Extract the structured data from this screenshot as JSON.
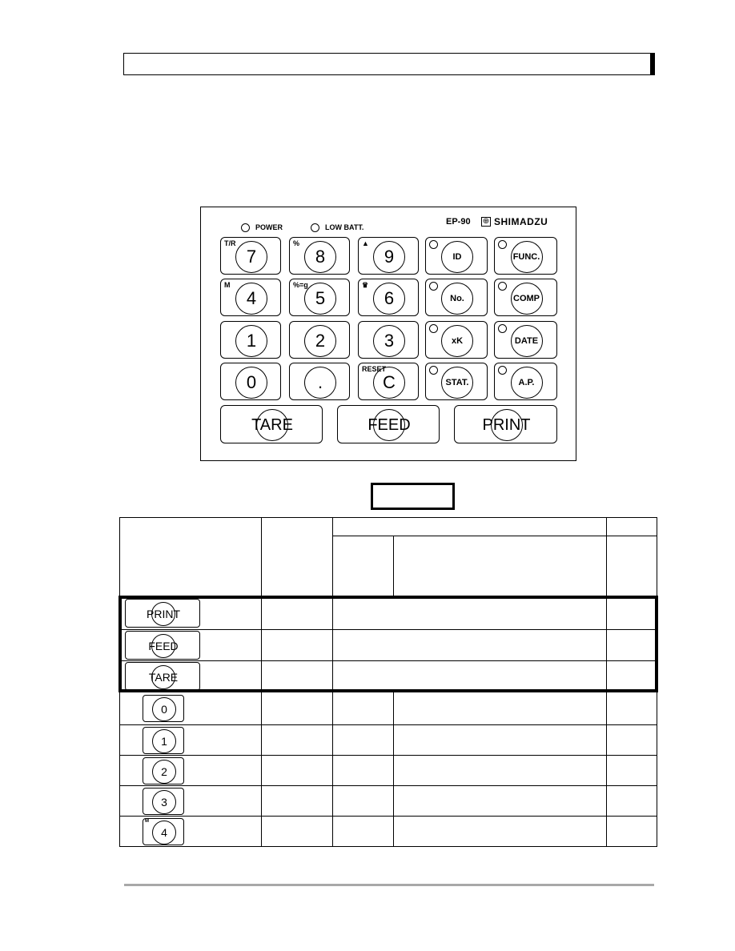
{
  "panel": {
    "model": "EP-90",
    "brand": "SHIMADZU",
    "indicators": [
      "POWER",
      "LOW BATT."
    ],
    "keys": [
      {
        "label": "7",
        "sub": "T/R"
      },
      {
        "label": "8",
        "sub": "%"
      },
      {
        "label": "9",
        "sub": "▲"
      },
      {
        "label": "ID",
        "led": true
      },
      {
        "label": "FUNC.",
        "led": true
      },
      {
        "label": "4",
        "sub": "M"
      },
      {
        "label": "5",
        "sub": "%=g"
      },
      {
        "label": "6",
        "sub": "♛"
      },
      {
        "label": "No.",
        "led": true
      },
      {
        "label": "COMP",
        "led": true
      },
      {
        "label": "1"
      },
      {
        "label": "2"
      },
      {
        "label": "3"
      },
      {
        "label": "xK",
        "led": true
      },
      {
        "label": "DATE",
        "led": true
      },
      {
        "label": "0"
      },
      {
        "label": "."
      },
      {
        "label": "C",
        "sub": "RESET"
      },
      {
        "label": "STAT.",
        "led": true
      },
      {
        "label": "A.P.",
        "led": true
      }
    ],
    "big_keys": [
      "TARE",
      "FEED",
      "PRINT"
    ]
  },
  "table": {
    "rows": [
      {
        "key": "PRINT",
        "sub": ""
      },
      {
        "key": "FEED",
        "sub": ""
      },
      {
        "key": "TARE",
        "sub": ""
      },
      {
        "key": "0",
        "sub": ""
      },
      {
        "key": "1",
        "sub": ""
      },
      {
        "key": "2",
        "sub": ""
      },
      {
        "key": "3",
        "sub": ""
      },
      {
        "key": "4",
        "sub": "M"
      }
    ]
  }
}
